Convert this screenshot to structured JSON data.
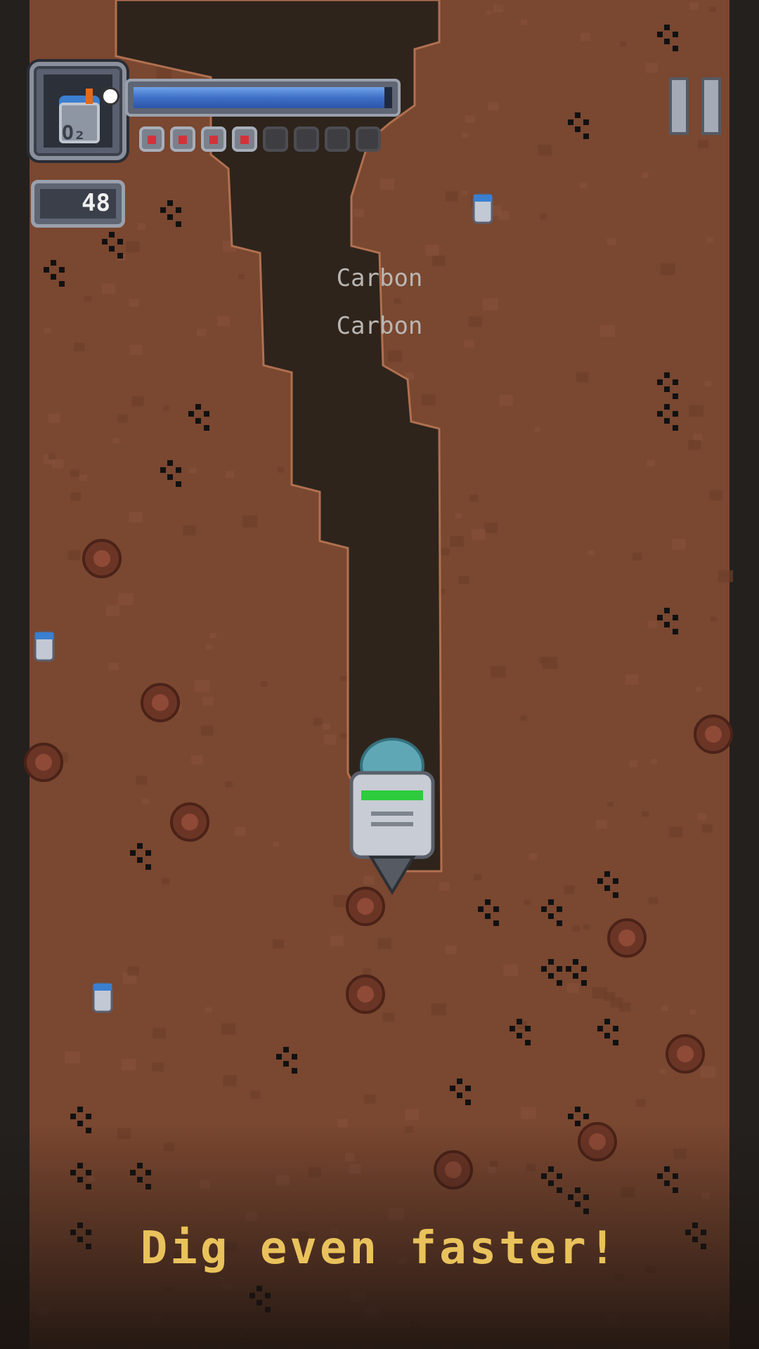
{
  "hud": {
    "oxygen_tank_label": "O₂",
    "oxygen_level_fraction": 0.97,
    "charges_total": 8,
    "charges_remaining": 4,
    "depth_value": "48",
    "pause_icon": "pause-icon"
  },
  "floating_labels": [
    "Carbon",
    "Carbon"
  ],
  "hint_text": "Dig even faster!",
  "world_items": {
    "oxygen_canisters": 3,
    "carbon_ore_clusters": 30,
    "rock_boulders": 14
  },
  "colors": {
    "dirt": "#7a4730",
    "dirt_spot": "#6d3e29",
    "tunnel": "#2e241c",
    "wall": "#23201e",
    "hint": "#e9c25c",
    "oxygen_fill": "#3e6fc7",
    "pip_on": "#d2333a"
  }
}
